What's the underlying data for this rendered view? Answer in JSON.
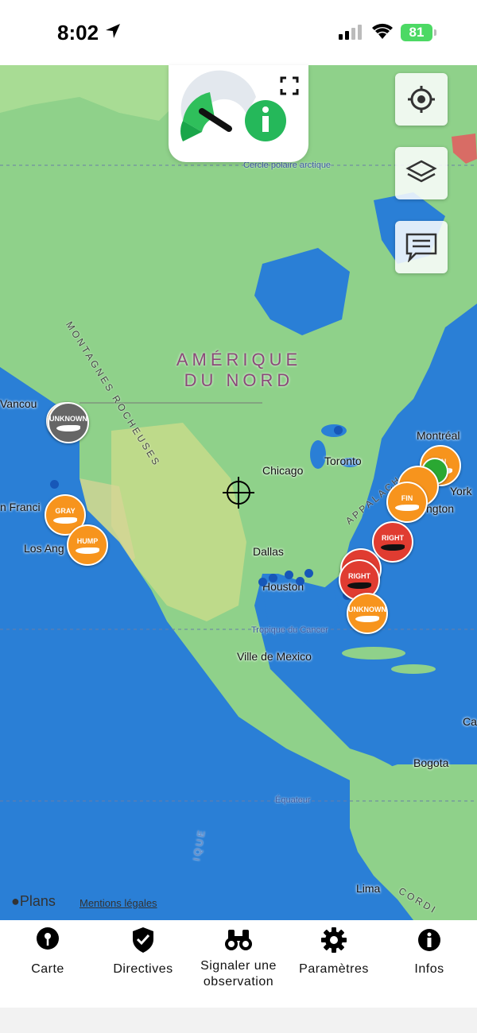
{
  "status_bar": {
    "time": "8:02",
    "battery": "81"
  },
  "map": {
    "continent_label_line1": "AMÉRIQUE",
    "continent_label_line2": "DU NORD",
    "mountains_label": "MONTAGNES ROCHEUSES",
    "appalaches_label": "APPALACH",
    "arctic_circle": "Cercle polaire arctique",
    "tropic": "Tropique du Cancer",
    "equator": "Équateur",
    "cities": {
      "vancouver": "Vancou",
      "san_francisco": "n Franci",
      "los_angeles": "Los Ang",
      "chicago": "Chicago",
      "toronto": "Toronto",
      "montreal": "Montréal",
      "new_york": "York",
      "washington": "ngton",
      "dallas": "Dallas",
      "houston": "Houston",
      "mexico": "Ville de Mexico",
      "bogota": "Bogota",
      "lima": "Lima",
      "caracas": "Ca"
    },
    "pacific_partial": "IQUE",
    "cordillera_partial": "CORDI",
    "markers": [
      {
        "id": "vancouver-unknown",
        "label": "UNKNOWN",
        "color": "#666666"
      },
      {
        "id": "sf-gray",
        "label": "GRAY",
        "color": "#f7941d"
      },
      {
        "id": "la-hump",
        "label": "HUMP",
        "color": "#f7941d"
      },
      {
        "id": "ne-fin",
        "label": "FIN",
        "color": "#f7941d"
      },
      {
        "id": "ne-fin-2",
        "label": "FIN",
        "color": "#f7941d"
      },
      {
        "id": "se-right",
        "label": "RIGHT",
        "color": "#e03c31"
      },
      {
        "id": "fl-right",
        "label": "RIGHT",
        "color": "#e03c31"
      },
      {
        "id": "fl-unknown",
        "label": "UNKNOWN",
        "color": "#f7941d"
      }
    ]
  },
  "attribution": {
    "plans": "Plans",
    "legal": "Mentions légales"
  },
  "tabs": [
    {
      "label": "Carte",
      "icon": "map-pin-icon"
    },
    {
      "label": "Directives",
      "icon": "shield-check-icon"
    },
    {
      "label": "Signaler une observation",
      "icon": "binoculars-icon"
    },
    {
      "label": "Paramètres",
      "icon": "gear-icon"
    },
    {
      "label": "Infos",
      "icon": "info-icon"
    }
  ],
  "colors": {
    "ocean": "#2a7fd6",
    "land": "#8fd18a",
    "orange_marker": "#f7941d",
    "red_marker": "#e03c31",
    "dot": "#1757b8"
  }
}
